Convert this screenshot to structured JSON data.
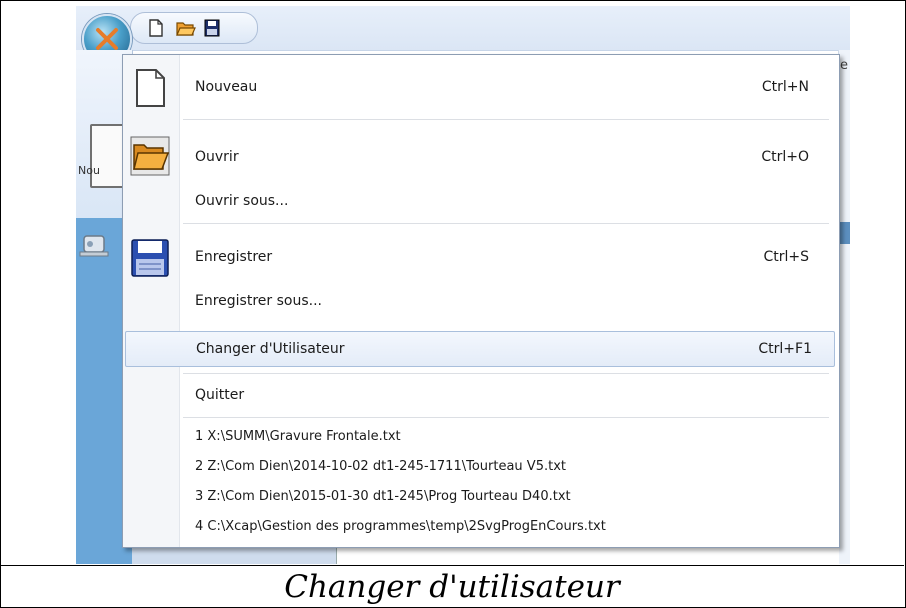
{
  "menu": {
    "items": [
      {
        "label": "Nouveau",
        "shortcut": "Ctrl+N"
      },
      {
        "label": "Ouvrir",
        "shortcut": "Ctrl+O"
      },
      {
        "label": "Ouvrir sous...",
        "shortcut": ""
      },
      {
        "label": "Enregistrer",
        "shortcut": "Ctrl+S"
      },
      {
        "label": "Enregistrer sous...",
        "shortcut": ""
      },
      {
        "label": "Changer d'Utilisateur",
        "shortcut": "Ctrl+F1"
      },
      {
        "label": "Quitter",
        "shortcut": ""
      }
    ],
    "highlighted_item": "Changer d'Utilisateur",
    "recent_files": [
      "1 X:\\SUMM\\Gravure Frontale.txt",
      "2 Z:\\Com Dien\\2014-10-02 dt1-245-1711\\Tourteau V5.txt",
      "3 Z:\\Com Dien\\2015-01-30 dt1-245\\Prog Tourteau D40.txt",
      "4 C:\\Xcap\\Gestion des programmes\\temp\\2SvgProgEnCours.txt"
    ]
  },
  "background": {
    "ribbon_label": "Nou",
    "right_edge_char": "e"
  },
  "caption": "Changer d'utilisateur",
  "icons": [
    "app-orb-icon",
    "new-file-icon",
    "open-folder-icon",
    "save-disk-icon",
    "robot-icon"
  ],
  "colors": {
    "highlight_bg": "#e4ecf8",
    "highlight_border": "#a9bfdc",
    "folder": "#f0a030",
    "disk": "#2b4fb0",
    "left_panel_blue": "#6aa6d8"
  }
}
